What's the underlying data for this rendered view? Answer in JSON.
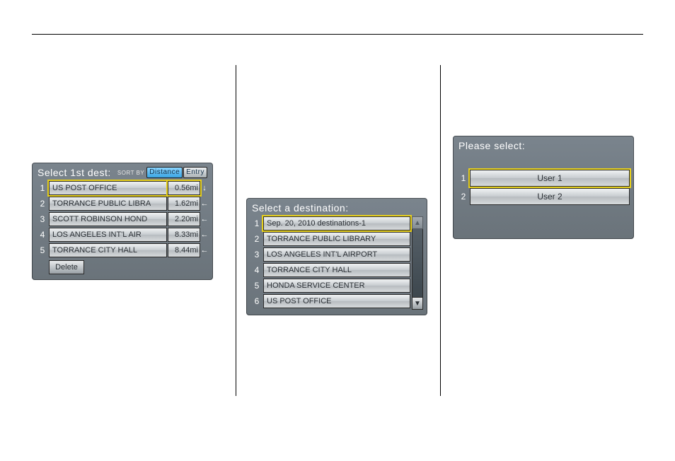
{
  "panel1": {
    "title": "Select 1st dest:",
    "sort_by_label": "SORT BY",
    "sort_distance": "Distance",
    "sort_entry": "Entry",
    "rows": [
      {
        "idx": "1",
        "name": "US POST OFFICE",
        "dist": "0.56mi",
        "arrow": "↓",
        "selected": true
      },
      {
        "idx": "2",
        "name": "TORRANCE PUBLIC LIBRA",
        "dist": "1.62mi",
        "arrow": "←"
      },
      {
        "idx": "3",
        "name": "SCOTT ROBINSON HOND",
        "dist": "2.20mi",
        "arrow": "←"
      },
      {
        "idx": "4",
        "name": "LOS ANGELES INT'L AIR",
        "dist": "8.33mi",
        "arrow": "←"
      },
      {
        "idx": "5",
        "name": "TORRANCE CITY HALL",
        "dist": "8.44mi",
        "arrow": "←"
      }
    ],
    "delete_label": "Delete"
  },
  "panel2": {
    "title": "Select a destination:",
    "rows": [
      {
        "idx": "1",
        "name": "Sep. 20, 2010 destinations-1",
        "selected": true
      },
      {
        "idx": "2",
        "name": "TORRANCE PUBLIC LIBRARY"
      },
      {
        "idx": "3",
        "name": "LOS ANGELES INT'L AIRPORT"
      },
      {
        "idx": "4",
        "name": "TORRANCE CITY HALL"
      },
      {
        "idx": "5",
        "name": "HONDA SERVICE CENTER"
      },
      {
        "idx": "6",
        "name": "US POST OFFICE"
      }
    ]
  },
  "panel3": {
    "title": "Please select:",
    "rows": [
      {
        "idx": "1",
        "name": "User 1",
        "selected": true
      },
      {
        "idx": "2",
        "name": "User 2"
      }
    ]
  }
}
